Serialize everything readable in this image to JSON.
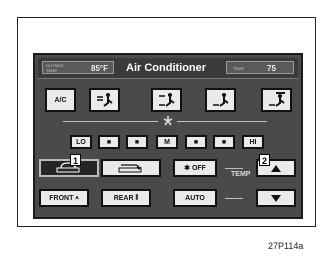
{
  "header": {
    "left_small_text": "OUTSIDE\nTEMP",
    "outside_temp": "85°F",
    "title": "Air Conditioner",
    "right_small_text": "TEMP",
    "set_temp": "75"
  },
  "mode_buttons": {
    "ac_label": "A/C"
  },
  "fan_speed": {
    "lo_label": "LO",
    "m_label": "M",
    "hi_label": "HI",
    "dot_label": "■"
  },
  "controls": {
    "fan_off_label": "OFF",
    "temp_label": "TEMP",
    "front_label": "FRONT",
    "rear_label": "REAR",
    "auto_label": "AUTO"
  },
  "callouts": {
    "one": "1",
    "two": "2"
  },
  "figure_code": "27P114a"
}
